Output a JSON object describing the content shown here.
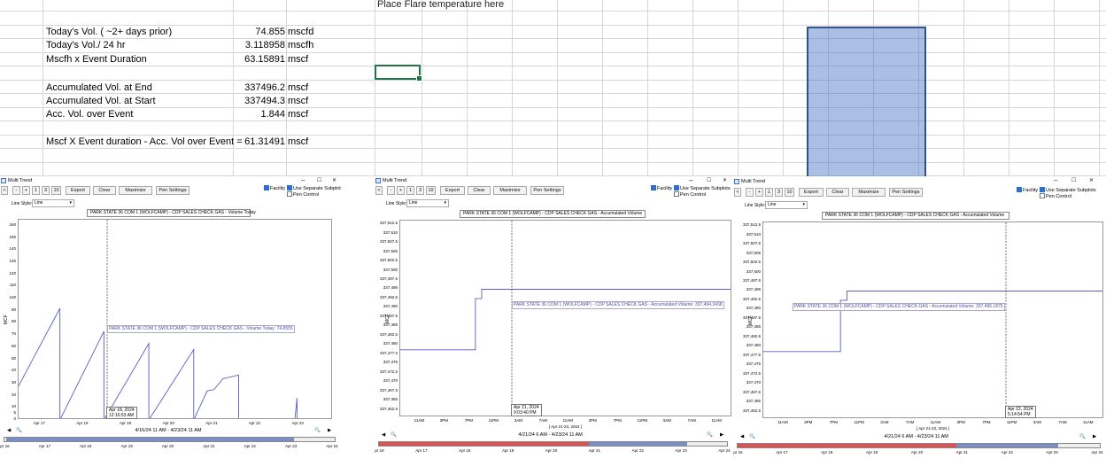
{
  "sheet": {
    "header_note": "Place Flare temperature here",
    "rows": [
      {
        "label": "Today's Vol. ( ~2+ days prior)",
        "value": "74.855",
        "unit": "mscfd"
      },
      {
        "label": "Today's Vol./ 24 hr",
        "value": "3.118958",
        "unit": "mscfh"
      },
      {
        "label": "Mscfh x Event Duration",
        "value": "63.15891",
        "unit": "mscf"
      },
      {
        "label": "Accumulated Vol. at End",
        "value": "337496.2",
        "unit": "mscf"
      },
      {
        "label": "Accumulated Vol. at Start",
        "value": "337494.3",
        "unit": "mscf"
      },
      {
        "label": "Acc. Vol. over Event",
        "value": "1.844",
        "unit": "mscf"
      },
      {
        "label": "Mscf X Event duration - Acc. Vol over Event =",
        "value": "61.31491",
        "unit": "mscf"
      }
    ]
  },
  "common": {
    "window_title": "Multi Trend",
    "buttons": {
      "back": "<",
      "minus": "-",
      "plus": "+",
      "b1": "1",
      "b3": "3",
      "b10": "10",
      "export": "Export",
      "clear": "Clear",
      "maximize": "Maximize",
      "pen_settings": "Pen Settings"
    },
    "facility": "Facility",
    "separate": "Use Separate Subplots",
    "pen_control": "Pen Control",
    "line_style_label": "Line Style:",
    "line_style_value": "Line",
    "ylabel": "MCF",
    "win_min": "–",
    "win_max": "☐",
    "win_close": "✕",
    "nav_left": "◀",
    "nav_right": "▶"
  },
  "windows": [
    {
      "legend": "PARK STATE 36 COM 1 (WOLFCAMP) - CDP SALES CHECK GAS - Volume Today",
      "annotation": "PARK STATE 36 COM 1 (WOLFCAMP) - CDP SALES CHECK GAS - Volume Today: 74.8555",
      "cursor_date": "Apr 18, 2024",
      "cursor_time": "12:16:53 AM",
      "range_label": "4/16/24 11 AM - 4/23/24 11 AM",
      "x_sub": "",
      "ticks": [
        "Apr 17",
        "Apr 18",
        "Apr 19",
        "Apr 20",
        "Apr 21",
        "Apr 22",
        "Apr 23"
      ],
      "range_ticks": [
        "Apr 16",
        "Apr 17",
        "Apr 18",
        "Apr 19",
        "Apr 20",
        "Apr 21",
        "Apr 22",
        "Apr 23",
        "Apr 24"
      ]
    },
    {
      "legend": "PARK STATE 36 COM 1 (WOLFCAMP) - CDP SALES CHECK GAS - Accumulated Volume",
      "annotation": "PARK STATE 36 COM 1 (WOLFCAMP) - CDP SALES CHECK GAS - Accumulated Volume: 337,494.3438",
      "cursor_date": "Apr 21, 2024",
      "cursor_time": "9:03:40 PM",
      "range_label": "4/21/24 6 AM - 4/23/24 11 AM",
      "x_sub": "[ Apr 21-23, 2024 ]",
      "ticks": [
        "11AM",
        "3PM",
        "7PM",
        "11PM",
        "3AM",
        "7AM",
        "11AM",
        "3PM",
        "7PM",
        "11PM",
        "3AM",
        "7AM",
        "11AM"
      ],
      "range_ticks": [
        "Apr 16",
        "Apr 17",
        "Apr 18",
        "Apr 19",
        "Apr 20",
        "Apr 21",
        "Apr 22",
        "Apr 23",
        "Apr 24"
      ]
    },
    {
      "legend": "PARK STATE 36 COM 1 (WOLFCAMP) - CDP SALES CHECK GAS - Accumulated Volume",
      "annotation": "PARK STATE 36 COM 1 (WOLFCAMP) - CDP SALES CHECK GAS - Accumulated Volume: 337,496.1875",
      "cursor_date": "Apr 22, 2024",
      "cursor_time": "5:14:54 PM",
      "range_label": "4/21/24 6 AM - 4/23/24 11 AM",
      "x_sub": "[ Apr 21-23, 2024 ]",
      "ticks": [
        "11AM",
        "3PM",
        "7PM",
        "11PM",
        "3AM",
        "7AM",
        "11AM",
        "3PM",
        "7PM",
        "11PM",
        "3AM",
        "7AM",
        "11AM"
      ],
      "range_ticks": [
        "Apr 16",
        "Apr 17",
        "Apr 18",
        "Apr 19",
        "Apr 20",
        "Apr 21",
        "Apr 22",
        "Apr 23",
        "Apr 24"
      ]
    }
  ],
  "chart_data": [
    {
      "type": "line",
      "title": "",
      "ylabel": "MCF",
      "ylim": [
        0,
        165
      ],
      "yticks": [
        0,
        5,
        10,
        20,
        30,
        40,
        50,
        60,
        70,
        80,
        90,
        100,
        110,
        120,
        130,
        140,
        150,
        160
      ],
      "x_range": [
        "Apr 16 11AM",
        "Apr 23 11AM"
      ],
      "series": [
        {
          "name": "PARK STATE 36 COM 1 (WOLFCAMP) - CDP SALES CHECK GAS - Volume Today",
          "x_days": [
            0,
            0.92,
            0.92,
            1.9,
            1.9,
            2.9,
            2.9,
            3.9,
            3.9,
            4.2,
            4.35,
            4.55,
            4.9,
            4.9,
            5.95,
            6.15,
            6.2,
            6.2
          ],
          "values": [
            28,
            92,
            0,
            73,
            0,
            63,
            0,
            58,
            0,
            24,
            25,
            34,
            37,
            0,
            0,
            0,
            18,
            0
          ]
        }
      ]
    },
    {
      "type": "line",
      "title": "",
      "ylabel": "MCF",
      "ylim": [
        337460.5,
        337513.5
      ],
      "yticks": [
        337462.5,
        337465,
        337467.5,
        337470,
        337472.5,
        337475,
        337477.5,
        337480,
        337482.5,
        337485,
        337487.5,
        337490,
        337492.5,
        337495,
        337497.5,
        337500,
        337502.5,
        337505,
        337507.5,
        337510,
        337512.5
      ],
      "series": [
        {
          "name": "PARK STATE 36 COM 1 (WOLFCAMP) - CDP SALES CHECK GAS - Accumulated Volume",
          "x_hours": [
            0,
            12,
            12,
            13,
            13,
            53
          ],
          "values": [
            337478.7,
            337478.7,
            337492.5,
            337492.5,
            337495,
            337495
          ]
        }
      ]
    },
    {
      "type": "line",
      "title": "",
      "ylabel": "MCF",
      "ylim": [
        337460.5,
        337513.5
      ],
      "yticks": [
        337462.5,
        337465,
        337467.5,
        337470,
        337472.5,
        337475,
        337477.5,
        337480,
        337482.5,
        337485,
        337487.5,
        337490,
        337492.5,
        337495,
        337497.5,
        337500,
        337502.5,
        337505,
        337507.5,
        337510,
        337512.5
      ],
      "series": [
        {
          "name": "PARK STATE 36 COM 1 (WOLFCAMP) - CDP SALES CHECK GAS - Accumulated Volume",
          "x_hours": [
            0,
            12,
            12,
            13,
            13,
            53
          ],
          "values": [
            337478.7,
            337478.7,
            337492.5,
            337492.5,
            337495,
            337495
          ]
        }
      ]
    }
  ]
}
